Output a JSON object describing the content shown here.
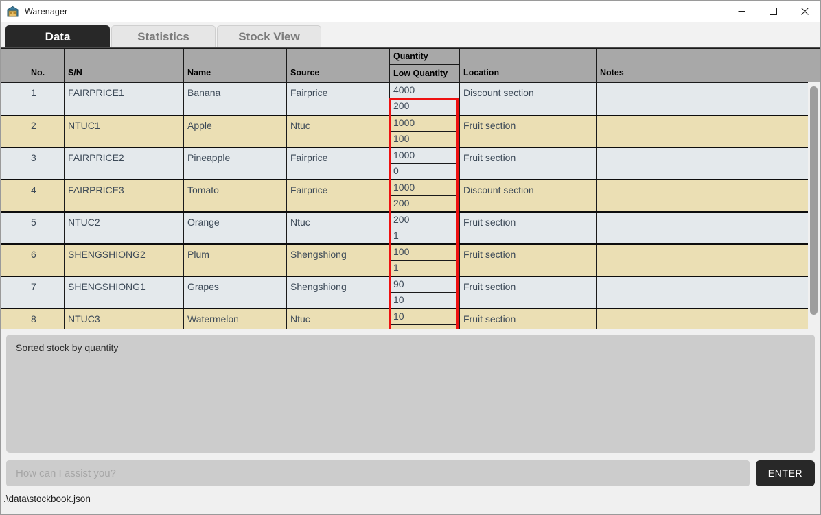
{
  "window": {
    "title": "Warenager",
    "icon": "warehouse-icon",
    "controls": {
      "minimize": "—",
      "maximize": "□",
      "close": "✕"
    }
  },
  "tabs": [
    {
      "label": "Data",
      "active": true
    },
    {
      "label": "Statistics",
      "active": false
    },
    {
      "label": "Stock View",
      "active": false
    }
  ],
  "table": {
    "columns": [
      {
        "key": "sel",
        "label": ""
      },
      {
        "key": "no",
        "label": "No."
      },
      {
        "key": "sn",
        "label": "S/N"
      },
      {
        "key": "name",
        "label": "Name"
      },
      {
        "key": "src",
        "label": "Source"
      },
      {
        "key": "qty",
        "label": "Quantity",
        "label2": "Low Quantity",
        "stacked": true
      },
      {
        "key": "loc",
        "label": "Location"
      },
      {
        "key": "notes",
        "label": "Notes"
      }
    ],
    "rows": [
      {
        "no": "1",
        "sn": "FAIRPRICE1",
        "name": "Banana",
        "src": "Fairprice",
        "qty": "4000",
        "low": "200",
        "loc": "Discount section",
        "notes": ""
      },
      {
        "no": "2",
        "sn": "NTUC1",
        "name": "Apple",
        "src": "Ntuc",
        "qty": "1000",
        "low": "100",
        "loc": "Fruit section",
        "notes": ""
      },
      {
        "no": "3",
        "sn": "FAIRPRICE2",
        "name": "Pineapple",
        "src": "Fairprice",
        "qty": "1000",
        "low": "0",
        "loc": "Fruit section",
        "notes": ""
      },
      {
        "no": "4",
        "sn": "FAIRPRICE3",
        "name": "Tomato",
        "src": "Fairprice",
        "qty": "1000",
        "low": "200",
        "loc": "Discount section",
        "notes": ""
      },
      {
        "no": "5",
        "sn": "NTUC2",
        "name": "Orange",
        "src": "Ntuc",
        "qty": "200",
        "low": "1",
        "loc": "Fruit section",
        "notes": ""
      },
      {
        "no": "6",
        "sn": "SHENGSHIONG2",
        "name": "Plum",
        "src": "Shengshiong",
        "qty": "100",
        "low": "1",
        "loc": "Fruit section",
        "notes": ""
      },
      {
        "no": "7",
        "sn": "SHENGSHIONG1",
        "name": "Grapes",
        "src": "Shengshiong",
        "qty": "90",
        "low": "10",
        "loc": "Fruit section",
        "notes": ""
      },
      {
        "no": "8",
        "sn": "NTUC3",
        "name": "Watermelon",
        "src": "Ntuc",
        "qty": "10",
        "low": "",
        "loc": "Fruit section",
        "notes": ""
      }
    ],
    "highlight": {
      "column": "Quantity / Low Quantity",
      "color": "#ee1111"
    }
  },
  "log": {
    "text": "Sorted stock by quantity"
  },
  "prompt": {
    "value": "",
    "placeholder": "How can I assist you?",
    "submit_label": "ENTER"
  },
  "status": {
    "path": ".\\data\\stockbook.json"
  },
  "colors": {
    "accent": "#f08228",
    "tab_active_bg": "#282828",
    "row_odd": "#e4e9ec",
    "row_even": "#ebdfb4",
    "header_bg": "#a8a8a8",
    "highlight": "#ee1111"
  }
}
